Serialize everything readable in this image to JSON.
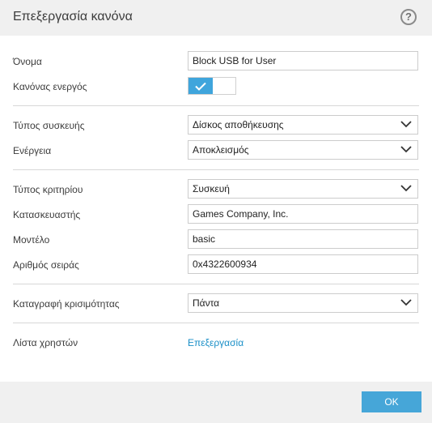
{
  "dialog": {
    "title": "Επεξεργασία κανόνα",
    "help_label": "?"
  },
  "fields": {
    "name": {
      "label": "Όνομα",
      "value": "Block USB for User"
    },
    "rule_enabled": {
      "label": "Κανόνας ενεργός",
      "state": "on"
    },
    "device_type": {
      "label": "Τύπος συσκευής",
      "value": "Δίσκος αποθήκευσης"
    },
    "action": {
      "label": "Ενέργεια",
      "value": "Αποκλεισμός"
    },
    "criteria_type": {
      "label": "Τύπος κριτηρίου",
      "value": "Συσκευή"
    },
    "vendor": {
      "label": "Κατασκευαστής",
      "value": "Games Company, Inc."
    },
    "model": {
      "label": "Μοντέλο",
      "value": "basic"
    },
    "serial": {
      "label": "Αριθμός σειράς",
      "value": "0x4322600934"
    },
    "log_severity": {
      "label": "Καταγραφή κρισιμότητας",
      "value": "Πάντα"
    },
    "user_list": {
      "label": "Λίστα χρηστών",
      "link": "Επεξεργασία"
    }
  },
  "footer": {
    "ok_label": "OK"
  },
  "colors": {
    "accent": "#3fa5dc",
    "link": "#1a8fc7",
    "header_bg": "#f0f0f0"
  }
}
